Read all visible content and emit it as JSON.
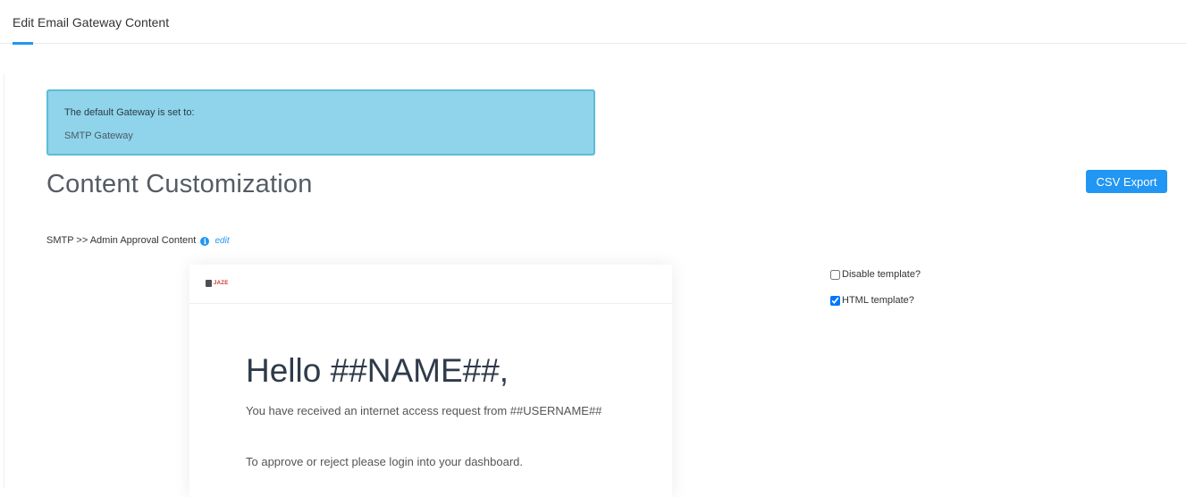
{
  "tabs": [
    {
      "label": "Edit Email Gateway Content",
      "active": true
    }
  ],
  "alert": {
    "title": "The default Gateway is set to:",
    "value": "SMTP Gateway"
  },
  "page": {
    "title": "Content Customization"
  },
  "toolbar": {
    "csv_export_label": "CSV Export"
  },
  "breadcrumb": {
    "text": "SMTP >> Admin Approval Content",
    "info_icon": "info-icon",
    "edit_label": "edit"
  },
  "email_preview": {
    "logo_text": "JAZE",
    "greeting": "Hello ##NAME##,",
    "line1": "You have received an internet access request from ##USERNAME##",
    "line2": "To approve or reject please login into your dashboard."
  },
  "options": {
    "disable_template": {
      "label": "Disable template?",
      "checked": false
    },
    "html_template": {
      "label": "HTML template?",
      "checked": true
    }
  },
  "colors": {
    "accent": "#2196f3",
    "alert_bg": "#8fd4eb",
    "alert_border": "#5bbcd9"
  }
}
